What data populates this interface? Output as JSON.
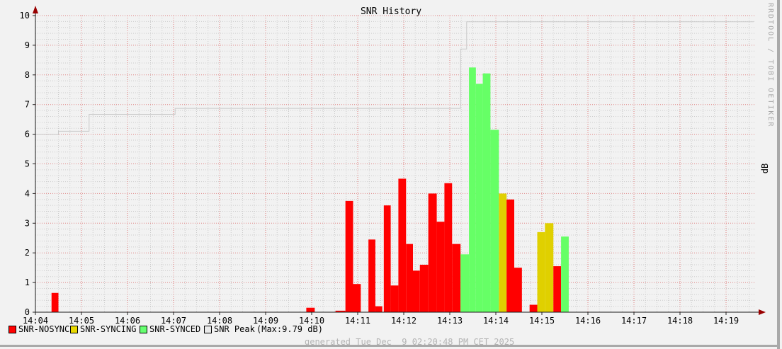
{
  "title": "SNR History",
  "watermark": "RRDTOOL / TOBI OETIKER",
  "right_axis_label": "dB",
  "footer": "generated Tue Dec  9 02:20:48 PM CET 2025",
  "legend": {
    "items": [
      {
        "label": "SNR-NOSYNC",
        "color": "#ff0000"
      },
      {
        "label": "SNR-SYNCING",
        "color": "#e8d800"
      },
      {
        "label": "SNR-SYNCED",
        "color": "#66ff70"
      },
      {
        "label": "SNR Peak",
        "color": "#e9e9e9"
      }
    ],
    "max_note": "(Max:9.79 dB)"
  },
  "chart_data": {
    "type": "bar",
    "title": "SNR History",
    "ylabel": "dB",
    "ylim": [
      0,
      10
    ],
    "grid": "on",
    "x_start_label": "14:04",
    "x_end_sec": 936,
    "x_tick_interval_sec": 60,
    "x_tick_labels": [
      "14:04",
      "14:05",
      "14:06",
      "14:07",
      "14:08",
      "14:09",
      "14:10",
      "14:11",
      "14:12",
      "14:13",
      "14:14",
      "14:15",
      "14:16",
      "14:17",
      "14:18",
      "14:19"
    ],
    "y_ticks": [
      0,
      1,
      2,
      3,
      4,
      5,
      6,
      7,
      8,
      9,
      10
    ],
    "series_colors": {
      "nosync": "#ff0000",
      "syncing": "#e0d000",
      "synced": "#66ff66",
      "peak": "#c9c9c9"
    },
    "bars_note": "t = seconds after 14:04:00, d = duration seconds, v = dB value, s = state series",
    "bars": [
      {
        "t": 21,
        "d": 9,
        "v": 0.65,
        "s": "nosync"
      },
      {
        "t": 353,
        "d": 11,
        "v": 0.15,
        "s": "nosync"
      },
      {
        "t": 391,
        "d": 13,
        "v": 0.05,
        "s": "nosync"
      },
      {
        "t": 404,
        "d": 10,
        "v": 3.75,
        "s": "nosync"
      },
      {
        "t": 414,
        "d": 10,
        "v": 0.95,
        "s": "nosync"
      },
      {
        "t": 434,
        "d": 9,
        "v": 2.45,
        "s": "nosync"
      },
      {
        "t": 443,
        "d": 9,
        "v": 0.2,
        "s": "nosync"
      },
      {
        "t": 454,
        "d": 9,
        "v": 3.6,
        "s": "nosync"
      },
      {
        "t": 463,
        "d": 10,
        "v": 0.9,
        "s": "nosync"
      },
      {
        "t": 473,
        "d": 10,
        "v": 4.5,
        "s": "nosync"
      },
      {
        "t": 483,
        "d": 9,
        "v": 2.3,
        "s": "nosync"
      },
      {
        "t": 492,
        "d": 9,
        "v": 1.4,
        "s": "nosync"
      },
      {
        "t": 501,
        "d": 11,
        "v": 1.6,
        "s": "nosync"
      },
      {
        "t": 512,
        "d": 11,
        "v": 4.0,
        "s": "nosync"
      },
      {
        "t": 523,
        "d": 10,
        "v": 3.05,
        "s": "nosync"
      },
      {
        "t": 533,
        "d": 10,
        "v": 4.35,
        "s": "nosync"
      },
      {
        "t": 543,
        "d": 11,
        "v": 2.3,
        "s": "nosync"
      },
      {
        "t": 554,
        "d": 11,
        "v": 1.95,
        "s": "synced"
      },
      {
        "t": 565,
        "d": 9,
        "v": 8.25,
        "s": "synced"
      },
      {
        "t": 574,
        "d": 9,
        "v": 7.7,
        "s": "synced"
      },
      {
        "t": 583,
        "d": 10,
        "v": 8.05,
        "s": "synced"
      },
      {
        "t": 593,
        "d": 11,
        "v": 6.15,
        "s": "synced"
      },
      {
        "t": 604,
        "d": 10,
        "v": 4.0,
        "s": "syncing"
      },
      {
        "t": 614,
        "d": 10,
        "v": 3.8,
        "s": "nosync"
      },
      {
        "t": 624,
        "d": 10,
        "v": 1.5,
        "s": "nosync"
      },
      {
        "t": 644,
        "d": 10,
        "v": 0.25,
        "s": "nosync"
      },
      {
        "t": 654,
        "d": 10,
        "v": 2.7,
        "s": "syncing"
      },
      {
        "t": 664,
        "d": 11,
        "v": 3.0,
        "s": "syncing"
      },
      {
        "t": 675,
        "d": 10,
        "v": 1.55,
        "s": "nosync"
      },
      {
        "t": 685,
        "d": 10,
        "v": 2.55,
        "s": "synced"
      }
    ],
    "peak_line": {
      "name": "SNR Peak",
      "max": 9.79,
      "points": [
        [
          0,
          6.0
        ],
        [
          30,
          6.1
        ],
        [
          70,
          6.67
        ],
        [
          182,
          6.87
        ],
        [
          554,
          8.87
        ],
        [
          562,
          9.79
        ]
      ]
    }
  }
}
